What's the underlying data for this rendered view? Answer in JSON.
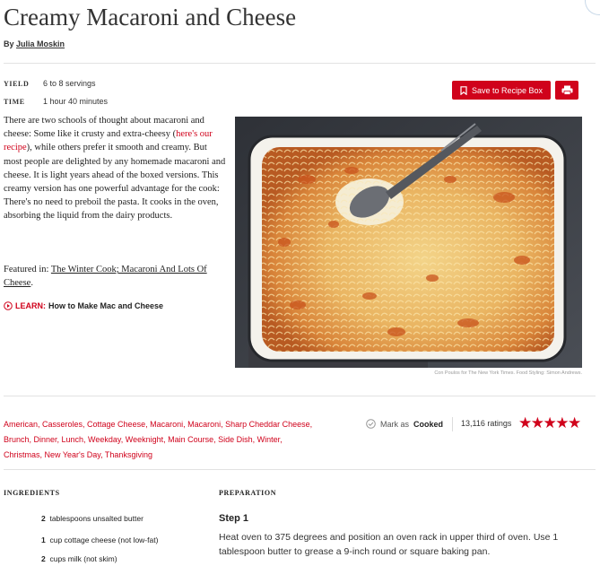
{
  "recipe": {
    "title": "Creamy Macaroni and Cheese",
    "byline_prefix": "By",
    "author": "Julia Moskin",
    "yield_label": "YIELD",
    "yield_value": "6 to 8 servings",
    "time_label": "TIME",
    "time_value": "1 hour 40 minutes"
  },
  "actions": {
    "save_label": "Save to Recipe Box",
    "accent_color": "#d0021b",
    "save_icon": "bookmark-icon",
    "print_icon": "printer-icon"
  },
  "intro": {
    "part1": "There are two schools of thought about macaroni and cheese: Some like it crusty and extra-cheesy (",
    "link": "here's our recipe",
    "part2": "), while others prefer it smooth and creamy. But most people are delighted by any homemade macaroni and cheese. It is light years ahead of the boxed versions. This creamy version has one powerful advantage for the cook: There's no need to preboil the pasta. It cooks in the oven, absorbing the liquid from the dairy products.",
    "featured_prefix": "Featured in:",
    "featured_link": "The Winter Cook; Macaroni And Lots Of Cheese",
    "featured_suffix": ".",
    "learn_label": "LEARN:",
    "learn_text": "How to Make Mac and Cheese"
  },
  "photo": {
    "credit": "Con Poulos for The New York Times. Food Styling: Simon Andrews."
  },
  "tags": {
    "line1": "American, Casseroles, Cottage Cheese, Macaroni, Macaroni, Sharp Cheddar Cheese,",
    "line2": "Brunch, Dinner, Lunch, Weekday, Weeknight, Main Course, Side Dish, Winter,",
    "line3": "Christmas, New Year's Day, Thanksgiving"
  },
  "rating": {
    "mark_as": "Mark as",
    "cooked": "Cooked",
    "count_text": "13,116 ratings",
    "stars": 5
  },
  "ingredients": {
    "heading": "INGREDIENTS",
    "items": [
      {
        "qty": "2",
        "text": "tablespoons unsalted butter"
      },
      {
        "qty": "1",
        "text": "cup cottage cheese (not low-fat)"
      },
      {
        "qty": "2",
        "text": "cups milk (not skim)"
      }
    ]
  },
  "preparation": {
    "heading": "PREPARATION",
    "step_title": "Step 1",
    "step_text": "Heat oven to 375 degrees and position an oven rack in upper third of oven. Use 1 tablespoon butter to grease a 9-inch round or square baking pan."
  }
}
